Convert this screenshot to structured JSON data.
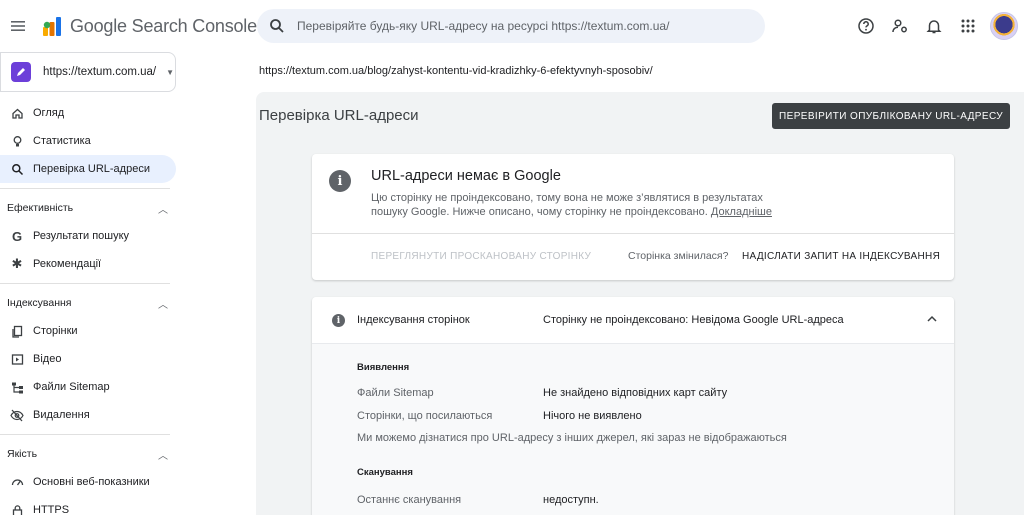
{
  "header": {
    "logo_text": "Google Search Console",
    "search_placeholder": "Перевіряйте будь-яку URL-адресу на ресурсі https://textum.com.ua/"
  },
  "sidebar": {
    "property": "https://textum.com.ua/",
    "top_items": [
      {
        "label": "Огляд",
        "icon": "home-icon"
      },
      {
        "label": "Статистика",
        "icon": "lightbulb-icon"
      },
      {
        "label": "Перевірка URL-адреси",
        "icon": "search-icon",
        "active": true
      }
    ],
    "sections": [
      {
        "label": "Ефективність",
        "items": [
          {
            "label": "Результати пошуку",
            "icon": "google-g-icon"
          },
          {
            "label": "Рекомендації",
            "icon": "sparkle-icon"
          }
        ]
      },
      {
        "label": "Індексування",
        "items": [
          {
            "label": "Сторінки",
            "icon": "pages-icon"
          },
          {
            "label": "Відео",
            "icon": "video-icon"
          },
          {
            "label": "Файли Sitemap",
            "icon": "sitemap-icon"
          },
          {
            "label": "Видалення",
            "icon": "eye-off-icon"
          }
        ]
      },
      {
        "label": "Якість",
        "items": [
          {
            "label": "Основні веб-показники",
            "icon": "gauge-icon"
          },
          {
            "label": "HTTPS",
            "icon": "lock-icon"
          }
        ]
      }
    ]
  },
  "main": {
    "inspected_url": "https://textum.com.ua/blog/zahyst-kontentu-vid-kradizhky-6-efektyvnyh-sposobiv/",
    "page_title": "Перевірка URL-адреси",
    "test_live_button": "ПЕРЕВІРИТИ ОПУБЛІКОВАНУ URL-АДРЕСУ",
    "status_card": {
      "title": "URL-адреси немає в Google",
      "desc": "Цю сторінку не проіндексовано, тому вона не може з’являтися в результатах пошуку Google. Нижче описано, чому сторінку не проіндексовано.",
      "link": "Докладніше",
      "view_crawled": "ПЕРЕГЛЯНУТИ ПРОСКАНОВАНУ СТОРІНКУ",
      "page_changed": "Сторінка змінилася?",
      "request_indexing": "НАДІСЛАТИ ЗАПИТ НА ІНДЕКСУВАННЯ"
    },
    "indexing_card": {
      "label": "Індексування сторінок",
      "value": "Сторінку не проіндексовано: Невідома Google URL-адреса",
      "discovery_heading": "Виявлення",
      "sitemaps_label": "Файли Sitemap",
      "sitemaps_value": "Не знайдено відповідних карт сайту",
      "referring_label": "Сторінки, що посилаються",
      "referring_value": "Нічого не виявлено",
      "note": "Ми можемо дізнатися про URL-адресу з інших джерел, які зараз не відображаються",
      "crawl_heading": "Сканування",
      "last_crawl_label": "Останнє сканування",
      "last_crawl_value": "недоступн."
    }
  },
  "colors": {
    "active_nav_bg": "#e8f0fe",
    "search_bg": "#eef2f9",
    "primary_button": "#3c4043",
    "property_icon": "#6c3fd9"
  }
}
